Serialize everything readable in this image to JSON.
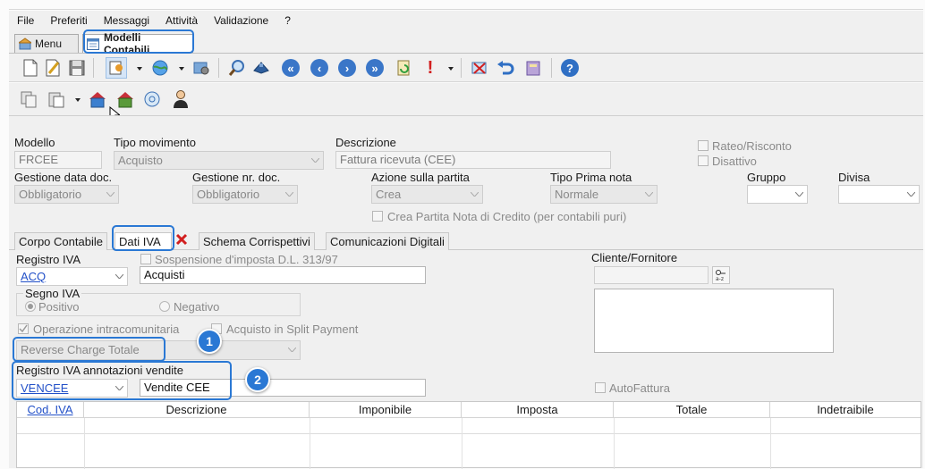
{
  "menu": [
    "File",
    "Preferiti",
    "Messaggi",
    "Attività",
    "Validazione",
    "?"
  ],
  "doc_tabs": [
    {
      "label": "Menu",
      "active": false
    },
    {
      "label": "Modelli Contabili",
      "active": true
    }
  ],
  "header": {
    "modello_label": "Modello",
    "modello_value": "FRCEE",
    "tipo_movimento_label": "Tipo movimento",
    "tipo_movimento_value": "Acquisto",
    "descrizione_label": "Descrizione",
    "descrizione_value": "Fattura ricevuta (CEE)",
    "rateo_label": "Rateo/Risconto",
    "disattivo_label": "Disattivo",
    "gestione_data_label": "Gestione data doc.",
    "gestione_data_value": "Obbligatorio",
    "gestione_nr_label": "Gestione nr. doc.",
    "gestione_nr_value": "Obbligatorio",
    "azione_label": "Azione sulla partita",
    "azione_value": "Crea",
    "tipo_prima_nota_label": "Tipo Prima nota",
    "tipo_prima_nota_value": "Normale",
    "gruppo_label": "Gruppo",
    "divisa_label": "Divisa",
    "crea_partita_label": "Crea Partita Nota di Credito (per contabili puri)"
  },
  "subtabs": [
    "Corpo Contabile",
    "Dati IVA",
    "Schema Corrispettivi",
    "Comunicazioni Digitali"
  ],
  "iva": {
    "registro_label": "Registro IVA",
    "registro_code": "ACQ",
    "registro_desc": "Acquisti",
    "sospensione_label": "Sospensione d'imposta D.L. 313/97",
    "cliente_label": "Cliente/Fornitore",
    "segno_label": "Segno IVA",
    "positivo_label": "Positivo",
    "negativo_label": "Negativo",
    "intracom_label": "Operazione intracomunitaria",
    "split_label": "Acquisto in Split Payment",
    "reverse_value": "Reverse Charge Totale",
    "annotazioni_label": "Registro IVA annotazioni vendite",
    "annotazioni_code": "VENCEE",
    "annotazioni_desc": "Vendite CEE",
    "autofattura_label": "AutoFattura"
  },
  "grid_headers": [
    "Cod. IVA",
    "Descrizione",
    "Imponibile",
    "Imposta",
    "Totale",
    "Indetraibile"
  ],
  "callouts": [
    "1",
    "2"
  ],
  "colors": {
    "accent": "#2a78d4",
    "link": "#2250c8"
  }
}
